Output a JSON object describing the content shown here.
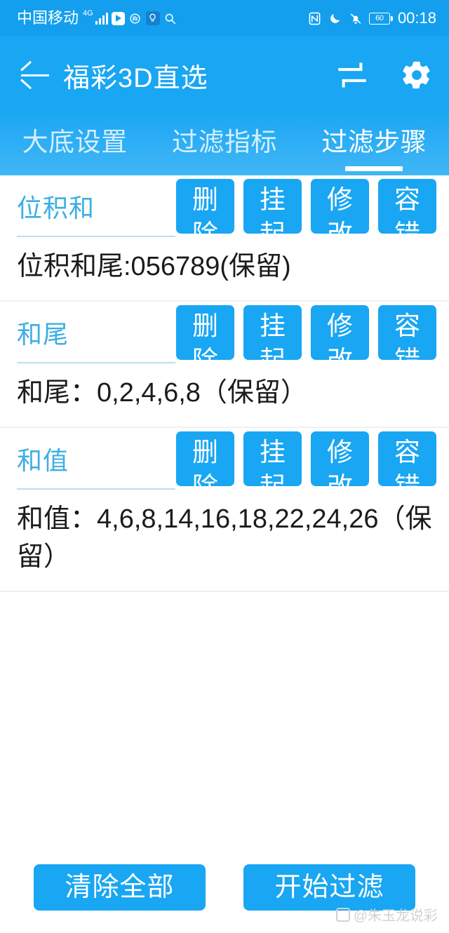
{
  "status_bar": {
    "carrier": "中国移动",
    "network_type": "4G",
    "signal_icon": "signal-bars-icon",
    "play_icon": "play-badge-icon",
    "hand_icon": "hand-stop-icon",
    "bulb_icon": "lightbulb-icon",
    "search_icon": "search-icon",
    "nfc_icon": "nfc-icon",
    "dnd_icon": "moon-do-not-disturb-icon",
    "mute_icon": "bell-muted-icon",
    "battery_level": "60",
    "time": "00:18"
  },
  "app_bar": {
    "back_icon": "back-arrow-icon",
    "title": "福彩3D直选",
    "swap_icon": "swap-repeat-icon",
    "settings_icon": "gear-icon"
  },
  "tabs": {
    "items": [
      {
        "label": "大底设置",
        "active": false
      },
      {
        "label": "过滤指标",
        "active": false
      },
      {
        "label": "过滤步骤",
        "active": true
      }
    ]
  },
  "row_actions": [
    {
      "name": "delete",
      "line1": "删",
      "line2": "除"
    },
    {
      "name": "suspend",
      "line1": "挂",
      "line2": "起"
    },
    {
      "name": "modify",
      "line1": "修",
      "line2": "改"
    },
    {
      "name": "tolerance",
      "line1": "容",
      "line2": "错"
    }
  ],
  "filters": [
    {
      "title": "位积和",
      "body": "位积和尾:056789(保留)"
    },
    {
      "title": "和尾",
      "body": "和尾：0,2,4,6,8（保留）"
    },
    {
      "title": "和值",
      "body": "和值：4,6,8,14,16,18,22,24,26（保留）"
    }
  ],
  "bottom_bar": {
    "clear_label": "清除全部",
    "start_label": "开始过滤"
  },
  "watermark": {
    "text": "@朱玉龙说彩"
  },
  "colors": {
    "primary": "#19a6f3",
    "status_bar": "#139fee",
    "tab_gradient_top": "#1ca7f3",
    "tab_gradient_bottom": "#41b6f6",
    "block_title": "#3caee4",
    "body_text": "#1b1b1b",
    "divider": "#f0f0f0",
    "head_underline": "#bcdff0"
  }
}
